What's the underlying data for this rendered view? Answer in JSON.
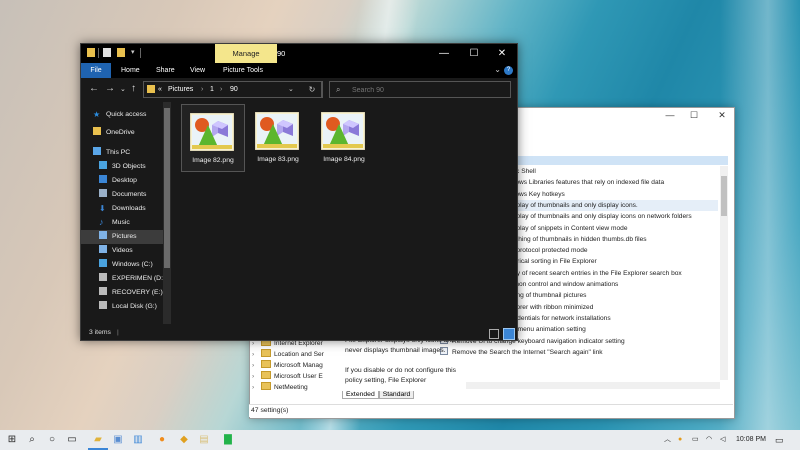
{
  "explorer": {
    "manage_tab": "Manage",
    "title": "90",
    "ribbon_tabs": [
      "File",
      "Home",
      "Share",
      "View",
      "Picture Tools"
    ],
    "path": [
      "«",
      "Pictures",
      "›",
      "1",
      "›",
      "90"
    ],
    "search_placeholder": "Search 90",
    "nav_items": [
      {
        "label": "Quick access",
        "icon": "star-icon",
        "color": "#2b8de0"
      },
      {
        "label": "OneDrive",
        "icon": "folder-icon",
        "color": "#e9c04e"
      },
      {
        "label": "This PC",
        "icon": "computer-icon",
        "color": "#5aa6e8"
      },
      {
        "label": "3D Objects",
        "icon": "cube-icon",
        "color": "#4aa3df"
      },
      {
        "label": "Desktop",
        "icon": "desktop-icon",
        "color": "#3b86d6"
      },
      {
        "label": "Documents",
        "icon": "documents-icon",
        "color": "#9ab0c8"
      },
      {
        "label": "Downloads",
        "icon": "download-icon",
        "color": "#3b86d6"
      },
      {
        "label": "Music",
        "icon": "music-icon",
        "color": "#3b86d6"
      },
      {
        "label": "Pictures",
        "icon": "pictures-icon",
        "color": "#7fb2e6"
      },
      {
        "label": "Videos",
        "icon": "videos-icon",
        "color": "#7fb2e6"
      },
      {
        "label": "Windows (C:)",
        "icon": "drive-icon",
        "color": "#4aa3df"
      },
      {
        "label": "EXPERIMEN (D:)",
        "icon": "drive-icon",
        "color": "#bbbbbb"
      },
      {
        "label": "RECOVERY (E:)",
        "icon": "drive-icon",
        "color": "#bbbbbb"
      },
      {
        "label": "Local Disk (G:)",
        "icon": "drive-icon",
        "color": "#bbbbbb"
      }
    ],
    "files": [
      "Image 82.png",
      "Image 83.png",
      "Image 84.png"
    ],
    "status_count": "3 items",
    "status_sep": "|"
  },
  "gp": {
    "policies": [
      "ssic Shell",
      "ndows Libraries features that rely on indexed file data",
      "ndows Key hotkeys",
      "display of thumbnails and only display icons.",
      "display of thumbnails and only display icons on network folders",
      "display of snippets in Content view mode",
      "caching of thumbnails in hidden thumbs.db files",
      "ell protocol protected mode",
      "merical sorting in File Explorer",
      "play of recent search entries in the File Explorer search box",
      "mmon control and window animations",
      "ching of thumbnail pictures",
      "xplorer with ribbon minimized",
      "credentials for network installations",
      "Remove UI to change menu animation setting",
      "Remove UI to change keyboard navigation indicator setting",
      "Remove the Search the Internet \"Search again\" link"
    ],
    "tree": [
      "Internet Explorer",
      "Location and Ser",
      "Microsoft Manag",
      "Microsoft User E",
      "NetMeeting"
    ],
    "description": "File Explorer displays only icons and never displays thumbnail images.\n\nIf you disable or do not configure this policy setting, File Explorer",
    "tabs": [
      "Extended",
      "Standard"
    ],
    "status": "47 setting(s)"
  },
  "taskbar": {
    "time": "10:08 PM"
  }
}
